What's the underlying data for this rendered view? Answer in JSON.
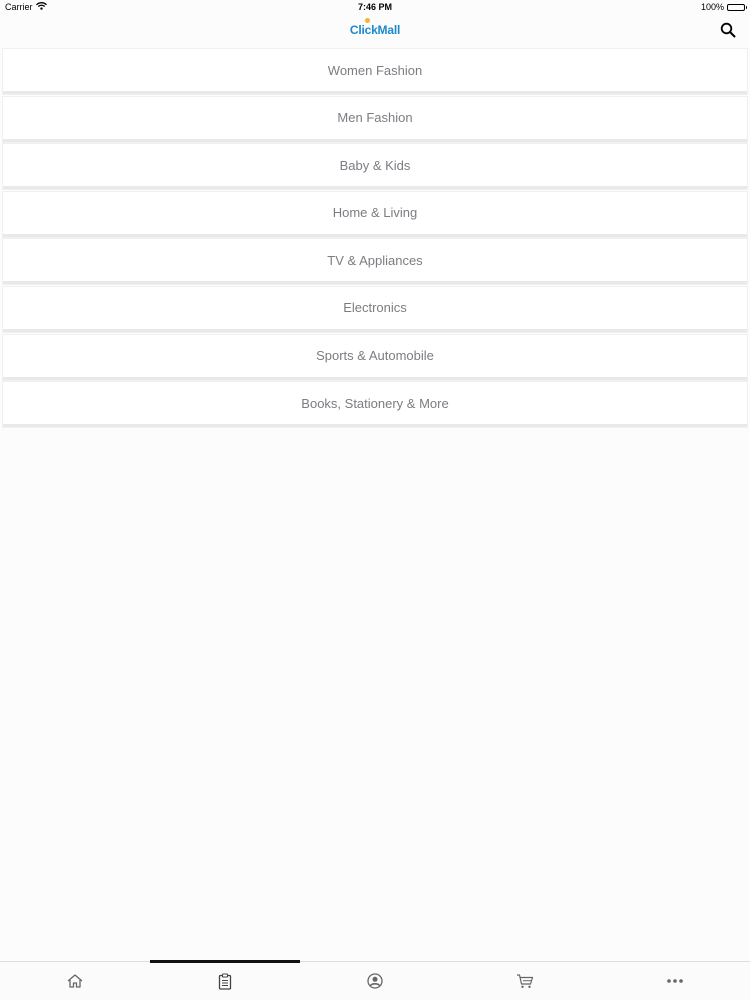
{
  "status_bar": {
    "carrier": "Carrier",
    "time": "7:46 PM",
    "battery": "100%"
  },
  "header": {
    "logo_text": "ClickMall",
    "search_icon": "search-icon"
  },
  "categories": [
    {
      "label": "Women Fashion"
    },
    {
      "label": "Men Fashion"
    },
    {
      "label": "Baby & Kids"
    },
    {
      "label": "Home & Living"
    },
    {
      "label": "TV & Appliances"
    },
    {
      "label": "Electronics"
    },
    {
      "label": "Sports & Automobile"
    },
    {
      "label": "Books, Stationery & More"
    }
  ],
  "tab_bar": {
    "tabs": [
      {
        "icon": "home-icon",
        "active": false
      },
      {
        "icon": "clipboard-icon",
        "active": true
      },
      {
        "icon": "profile-icon",
        "active": false
      },
      {
        "icon": "cart-icon",
        "active": false
      },
      {
        "icon": "more-icon",
        "active": false
      }
    ]
  },
  "colors": {
    "logo_blue": "#1e88c8",
    "logo_accent": "#f2b728",
    "category_text": "#7c7c82",
    "active_tab_indicator": "#111111"
  }
}
